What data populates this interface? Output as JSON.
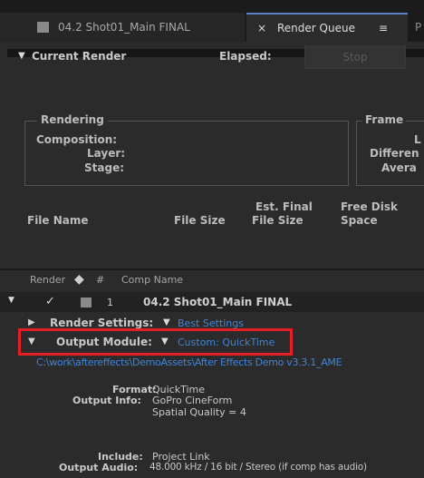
{
  "tabs": {
    "shot_label": "04.2 Shot01_Main FINAL",
    "close_glyph": "×",
    "render_queue_label": "Render Queue",
    "menu_glyph": "≡",
    "partial_label": "P"
  },
  "current_render": {
    "title": "Current Render",
    "elapsed_label": "Elapsed:",
    "stop_label": "Stop"
  },
  "rendering": {
    "section": "Rendering",
    "composition": "Composition:",
    "layer": "Layer:",
    "stage": "Stage:"
  },
  "frames": {
    "section": "Frame",
    "label1": "L",
    "label2": "Differen",
    "label3": "Avera"
  },
  "files": {
    "file_name": "File Name",
    "file_size": "File Size",
    "est_final_l1": "Est. Final",
    "est_final_l2": "File Size",
    "free_disk_l1": "Free Disk",
    "free_disk_l2": "Space"
  },
  "columns": {
    "render": "Render",
    "hash": "#",
    "comp_name": "Comp Name"
  },
  "item": {
    "check": "✓",
    "number": "1",
    "comp_name": "04.2 Shot01_Main FINAL"
  },
  "render_settings": {
    "label": "Render Settings:",
    "value": "Best Settings"
  },
  "output_module": {
    "label": "Output Module:",
    "value": "Custom: QuickTime",
    "path": "C:\\work\\aftereffects\\DemoAssets\\After Effects Demo v3.3.1_AME"
  },
  "output_details": {
    "format_label": "Format:",
    "format_value": "QuickTime",
    "info_label": "Output Info:",
    "info_line1": "GoPro CineForm",
    "info_line2": "Spatial Quality = 4",
    "include_label": "Include:",
    "include_value": "Project Link",
    "audio_label": "Output Audio:",
    "audio_value": "48.000 kHz / 16 bit / Stereo (if comp has audio)"
  },
  "colors": {
    "accent": "#3f84d6",
    "highlight": "#e31e24"
  }
}
